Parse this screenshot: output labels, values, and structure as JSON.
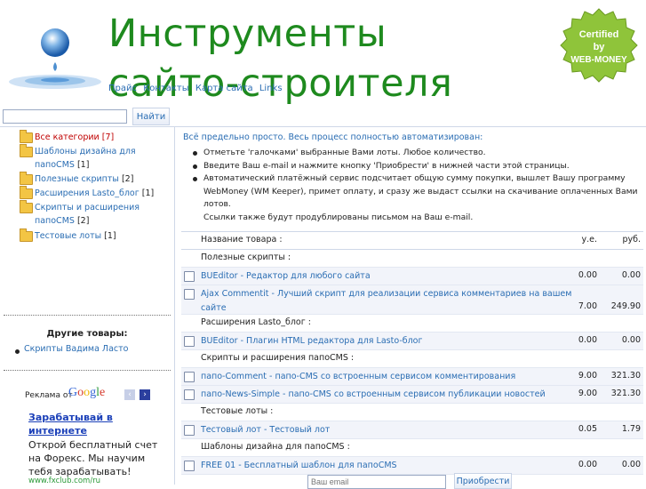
{
  "header": {
    "title": "Инструменты сайто-строителя",
    "badge": {
      "line1": "Certified",
      "line2": "by",
      "line3": "WEB-MONEY"
    },
    "nav": [
      "Прайс",
      "Контакты",
      "Карта сайта",
      "Links"
    ]
  },
  "search": {
    "input_value": "",
    "button_label": "Найти"
  },
  "sidebar": {
    "categories": [
      {
        "label": "Все категории",
        "count": "[7]"
      },
      {
        "label": "Шаблоны дизайна для папоCMS",
        "count": "[1]"
      },
      {
        "label": "Полезные скрипты",
        "count": "[2]"
      },
      {
        "label": "Расширения Lasto_блог",
        "count": "[1]"
      },
      {
        "label": "Скрипты и расширения папоCMS",
        "count": "[2]"
      },
      {
        "label": "Тестовые лоты",
        "count": "[1]"
      }
    ],
    "other_goods_title": "Другие товары:",
    "other_goods_item": "Скрипты Вадима Ласто"
  },
  "ads": {
    "label": "Реклама от",
    "provider": "Google",
    "prev": "‹",
    "next": "›",
    "title": "Зарабатывай в интернете",
    "text": "Открой бесплатный счет на Форекс. Мы научим тебя зарабатывать!",
    "url": "www.fxclub.com/ru"
  },
  "main": {
    "intro": "Всё предельно просто. Весь процесс полностью автоматизирован:",
    "bullets": [
      "Отметьте 'галочками' выбранные Вами лоты. Любое количество.",
      "Введите Ваш e-mail и нажмите кнопку 'Приобрести' в нижней части этой страницы.",
      "Автоматический платёжный сервис подсчитает общую сумму покупки, вышлет Вашу программу WebMoney (WM Keeper), примет оплату, и сразу же выдаст ссылки на скачивание оплаченных Вами лотов."
    ],
    "bullet_note": "Ссылки также будут продублированы письмом на Ваш e-mail.",
    "table": {
      "col_name": "Название товара :",
      "col_ue": "у.е.",
      "col_rub": "руб."
    },
    "groups": [
      {
        "title": "Полезные скрипты :",
        "items": [
          {
            "name": "BUEditor - Редактор для любого сайта",
            "ue": "0.00",
            "rub": "0.00"
          },
          {
            "name": "Ajax Commentit - Лучший скрипт для реализации сервиса комментариев на вашем сайте",
            "ue": "7.00",
            "rub": "249.90"
          }
        ]
      },
      {
        "title": "Расширения Lasto_блог :",
        "items": [
          {
            "name": "BUEditor - Плагин HTML редактора для Lasto-блог",
            "ue": "0.00",
            "rub": "0.00"
          }
        ]
      },
      {
        "title": "Скрипты и расширения папоCMS :",
        "items": [
          {
            "name": "папо-Comment - папо-CMS со встроенным сервисом комментирования",
            "ue": "9.00",
            "rub": "321.30"
          },
          {
            "name": "папо-News-Simple - папо-CMS со встроенным сервисом публикации новостей",
            "ue": "9.00",
            "rub": "321.30"
          }
        ]
      },
      {
        "title": "Тестовые лоты :",
        "items": [
          {
            "name": "Тестовый лот - Тестовый лот",
            "ue": "0.05",
            "rub": "1.79"
          }
        ]
      },
      {
        "title": "Шаблоны дизайна для папоCMS :",
        "items": [
          {
            "name": "FREE 01 - Бесплатный шаблон для папоCMS",
            "ue": "0.00",
            "rub": "0.00"
          }
        ]
      }
    ],
    "email_placeholder": "Ваш email",
    "buy_label": "Приобрести"
  },
  "colors": {
    "title_green": "#1e8a1e",
    "link_blue": "#2a6db3",
    "active_red": "#c00000",
    "badge_green": "#8fc43a"
  },
  "icons": [
    "water-drop-logo",
    "certified-badge-icon",
    "folder-icon",
    "home-folder-icon",
    "checkbox"
  ]
}
